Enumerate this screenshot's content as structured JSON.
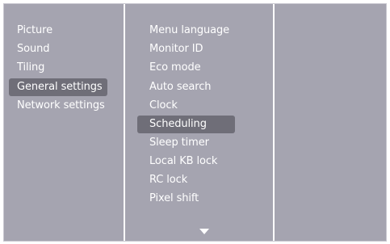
{
  "main_menu": {
    "items": [
      {
        "label": "Picture",
        "selected": false
      },
      {
        "label": "Sound",
        "selected": false
      },
      {
        "label": "Tiling",
        "selected": false
      },
      {
        "label": "General settings",
        "selected": true
      },
      {
        "label": "Network settings",
        "selected": false
      }
    ]
  },
  "sub_menu": {
    "items": [
      {
        "label": "Menu language",
        "selected": false
      },
      {
        "label": "Monitor ID",
        "selected": false
      },
      {
        "label": "Eco mode",
        "selected": false
      },
      {
        "label": "Auto search",
        "selected": false
      },
      {
        "label": "Clock",
        "selected": false
      },
      {
        "label": "Scheduling",
        "selected": true
      },
      {
        "label": "Sleep timer",
        "selected": false
      },
      {
        "label": "Local KB lock",
        "selected": false
      },
      {
        "label": "RC lock",
        "selected": false
      },
      {
        "label": "Pixel shift",
        "selected": false
      }
    ],
    "more_indicator": "down-arrow-icon"
  },
  "colors": {
    "panel_background": "#a5a4b0",
    "selection_highlight": "#6f6e78",
    "divider": "#ffffff",
    "text": "#ffffff"
  }
}
